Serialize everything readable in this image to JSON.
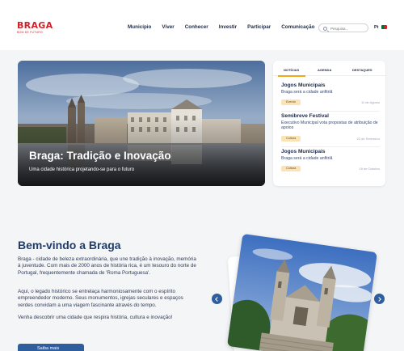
{
  "header": {
    "logo": {
      "name": "BRAGA",
      "tagline": "BOM DE FUTURO"
    },
    "nav": [
      "Município",
      "Viver",
      "Conhecer",
      "Investir",
      "Participar",
      "Comunicação"
    ],
    "search_placeholder": "Pesquisa...",
    "language": "Pt"
  },
  "hero": {
    "title": "Braga: Tradição e Inovação",
    "subtitle": "Uma cidade histórica projetando-se para o futuro"
  },
  "news": {
    "tabs": [
      "NOTÍCIAS",
      "AGENDA",
      "DESTAQUES"
    ],
    "active_tab": 0,
    "items": [
      {
        "title": "Jogos Municipais",
        "desc": "Braga será a cidade anfitriã",
        "tag": "Evento",
        "date": "11 de Agosto"
      },
      {
        "title": "Semibreve Festival",
        "desc": "Executivo Municipal vota propostas de atribuição de apoios",
        "tag": "Cultura",
        "date": "22 de Setembro"
      },
      {
        "title": "Jogos Municipais",
        "desc": "Braga será a cidade anfitriã",
        "tag": "Cultura",
        "date": "19 de Outubro"
      }
    ]
  },
  "welcome": {
    "title": "Bem-vindo a Braga",
    "p1": "Braga - cidade de beleza extraordinária, que une tradição à inovação, memória à juventude. Com mais de 2000 anos de história rica, é um tesouro do norte de Portugal, frequentemente chamada de 'Roma Portuguesa'.",
    "p2": "Aqui, o legado histórico se entrelaça harmoniosamente com o espírito empreendedor moderno. Seus monumentos, igrejas seculares e espaços verdes convidam a uma viagem fascinante através do tempo.",
    "p3": "Venha descobrir uma cidade que respira história, cultura e inovação!",
    "cta": "Saiba mais"
  },
  "colors": {
    "brand_red": "#d4202a",
    "navy": "#1f2a44",
    "accent_blue": "#2f5e9e",
    "tag_bg": "#fbe3b8"
  }
}
